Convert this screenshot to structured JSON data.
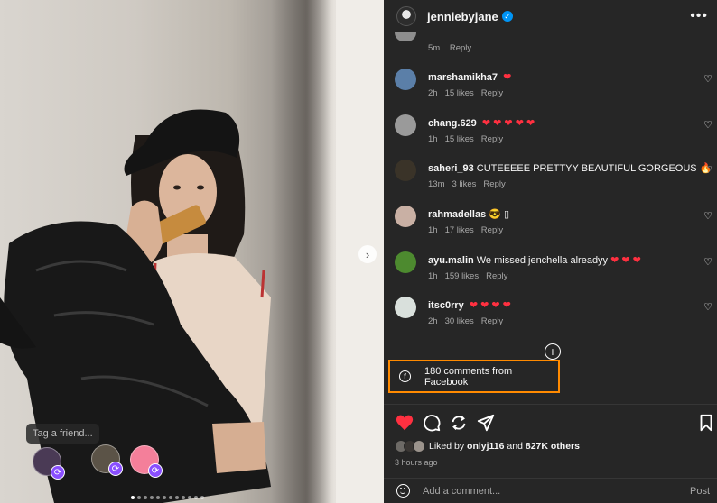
{
  "post": {
    "username": "jenniebyjane",
    "verified_icon": "verified-badge-icon",
    "more_icon": "ellipsis-icon",
    "time_ago": "3 hours ago",
    "likes_by": "onlyj116",
    "likes_others": "827K others",
    "likes_prefix": "Liked by",
    "likes_and": "and"
  },
  "photo": {
    "tag_prompt": "Tag a friend...",
    "next_arrow": "›",
    "slide_count": 12,
    "active_slide": 1
  },
  "partial_comment": {
    "time": "5m",
    "reply": "Reply"
  },
  "comments": [
    {
      "user": "marshamikha7",
      "text": "",
      "emoji": "❤",
      "time": "2h",
      "likes": "15 likes",
      "reply": "Reply",
      "avatar_color": "#5b7fa8"
    },
    {
      "user": "chang.629",
      "text": "",
      "emoji": "❤ ❤ ❤ ❤ ❤",
      "time": "1h",
      "likes": "15 likes",
      "reply": "Reply",
      "avatar_color": "#9a9a9a"
    },
    {
      "user": "saheri_93",
      "text": "CUTEEEEE PRETTYY BEAUTIFUL GORGEOUS",
      "emoji": "🔥",
      "time": "13m",
      "likes": "3 likes",
      "reply": "Reply",
      "avatar_color": "#3a3328"
    },
    {
      "user": "rahmadellas",
      "text": "😎 ▯",
      "emoji": "",
      "time": "1h",
      "likes": "17 likes",
      "reply": "Reply",
      "avatar_color": "#c9b0a4"
    },
    {
      "user": "ayu.malin",
      "text": "We missed jenchella alreadyy",
      "emoji": "❤ ❤ ❤",
      "time": "1h",
      "likes": "159 likes",
      "reply": "Reply",
      "avatar_color": "#4d8a2f"
    },
    {
      "user": "itsc0rry",
      "text": "",
      "emoji": "❤ ❤ ❤ ❤",
      "time": "2h",
      "likes": "30 likes",
      "reply": "Reply",
      "avatar_color": "#d9e0dc"
    }
  ],
  "facebook": {
    "icon": "f",
    "text": "180 comments from Facebook"
  },
  "add_comment": {
    "placeholder": "Add a comment...",
    "post_label": "Post"
  },
  "colors": {
    "accent_highlight": "#ff8a00",
    "like_red": "#ff3040",
    "verified_blue": "#0095f6",
    "panel_bg": "#262626"
  }
}
